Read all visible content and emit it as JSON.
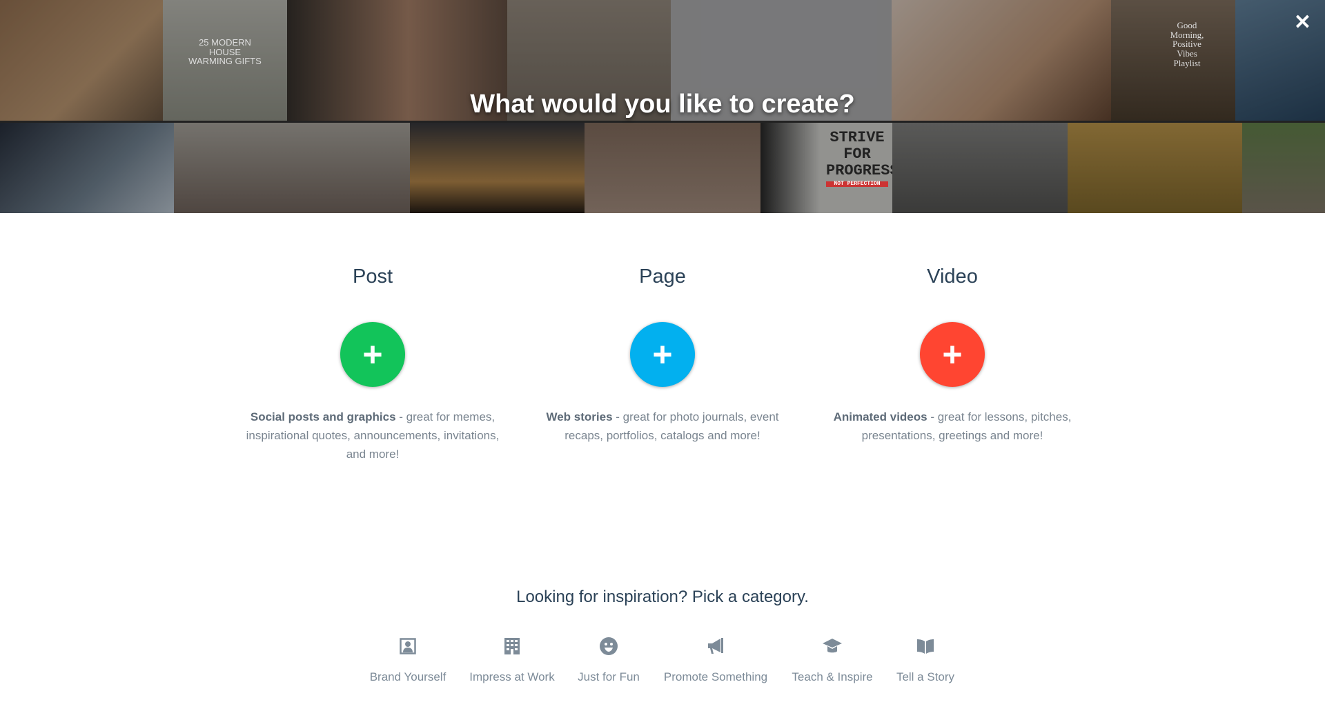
{
  "hero": {
    "title": "What would you like to create?",
    "close_icon": "close-icon",
    "tile_texts": {
      "housewarming": "25 MODERN HOUSE WARMING GIFTS",
      "playlist": "Good Morning, Positive Vibes Playlist",
      "strive": "STRIVE FOR PROGRESS",
      "strive_sub": "NOT PERFECTION"
    }
  },
  "options": [
    {
      "title": "Post",
      "color": "#12c45a",
      "bold": "Social posts and graphics",
      "text": " - great for memes, inspirational quotes, announcements, invitations, and more!"
    },
    {
      "title": "Page",
      "color": "#02b0ef",
      "bold": "Web stories",
      "text": " - great for photo journals, event recaps, portfolios, catalogs and more!"
    },
    {
      "title": "Video",
      "color": "#ff4531",
      "bold": "Animated videos",
      "text": " - great for lessons, pitches, presentations, greetings and more!"
    }
  ],
  "inspiration": {
    "heading": "Looking for inspiration? Pick a category.",
    "categories": [
      {
        "label": "Brand Yourself",
        "icon": "portrait-icon"
      },
      {
        "label": "Impress at Work",
        "icon": "building-icon"
      },
      {
        "label": "Just for Fun",
        "icon": "smiley-icon"
      },
      {
        "label": "Promote Something",
        "icon": "megaphone-icon"
      },
      {
        "label": "Teach & Inspire",
        "icon": "graduation-cap-icon"
      },
      {
        "label": "Tell a Story",
        "icon": "book-icon"
      }
    ]
  }
}
